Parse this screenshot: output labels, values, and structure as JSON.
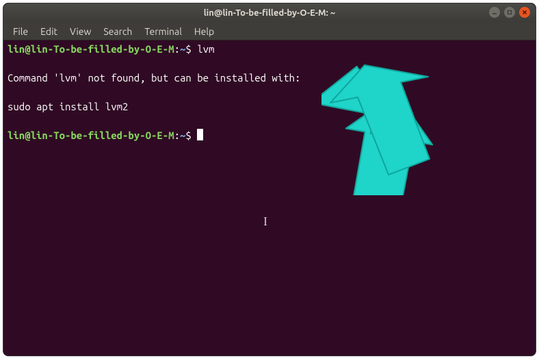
{
  "titlebar": {
    "title": "lin@lin-To-be-filled-by-O-E-M: ~"
  },
  "menubar": {
    "items": [
      "File",
      "Edit",
      "View",
      "Search",
      "Terminal",
      "Help"
    ]
  },
  "terminal": {
    "prompt_user": "lin@lin-To-be-filled-by-O-E-M",
    "prompt_path": "~",
    "lines": [
      {
        "type": "prompt",
        "cmd": "lvm"
      },
      {
        "type": "blank"
      },
      {
        "type": "output",
        "text": "Command 'lvm' not found, but can be installed with:"
      },
      {
        "type": "blank"
      },
      {
        "type": "output",
        "text": "sudo apt install lvm2"
      },
      {
        "type": "blank"
      },
      {
        "type": "prompt_cursor",
        "cmd": ""
      }
    ]
  },
  "colors": {
    "bg": "#300a24",
    "prompt_user": "#87d75f",
    "prompt_path": "#729fcf",
    "accent_close": "#e95420",
    "arrow": "#1fd4c9"
  }
}
